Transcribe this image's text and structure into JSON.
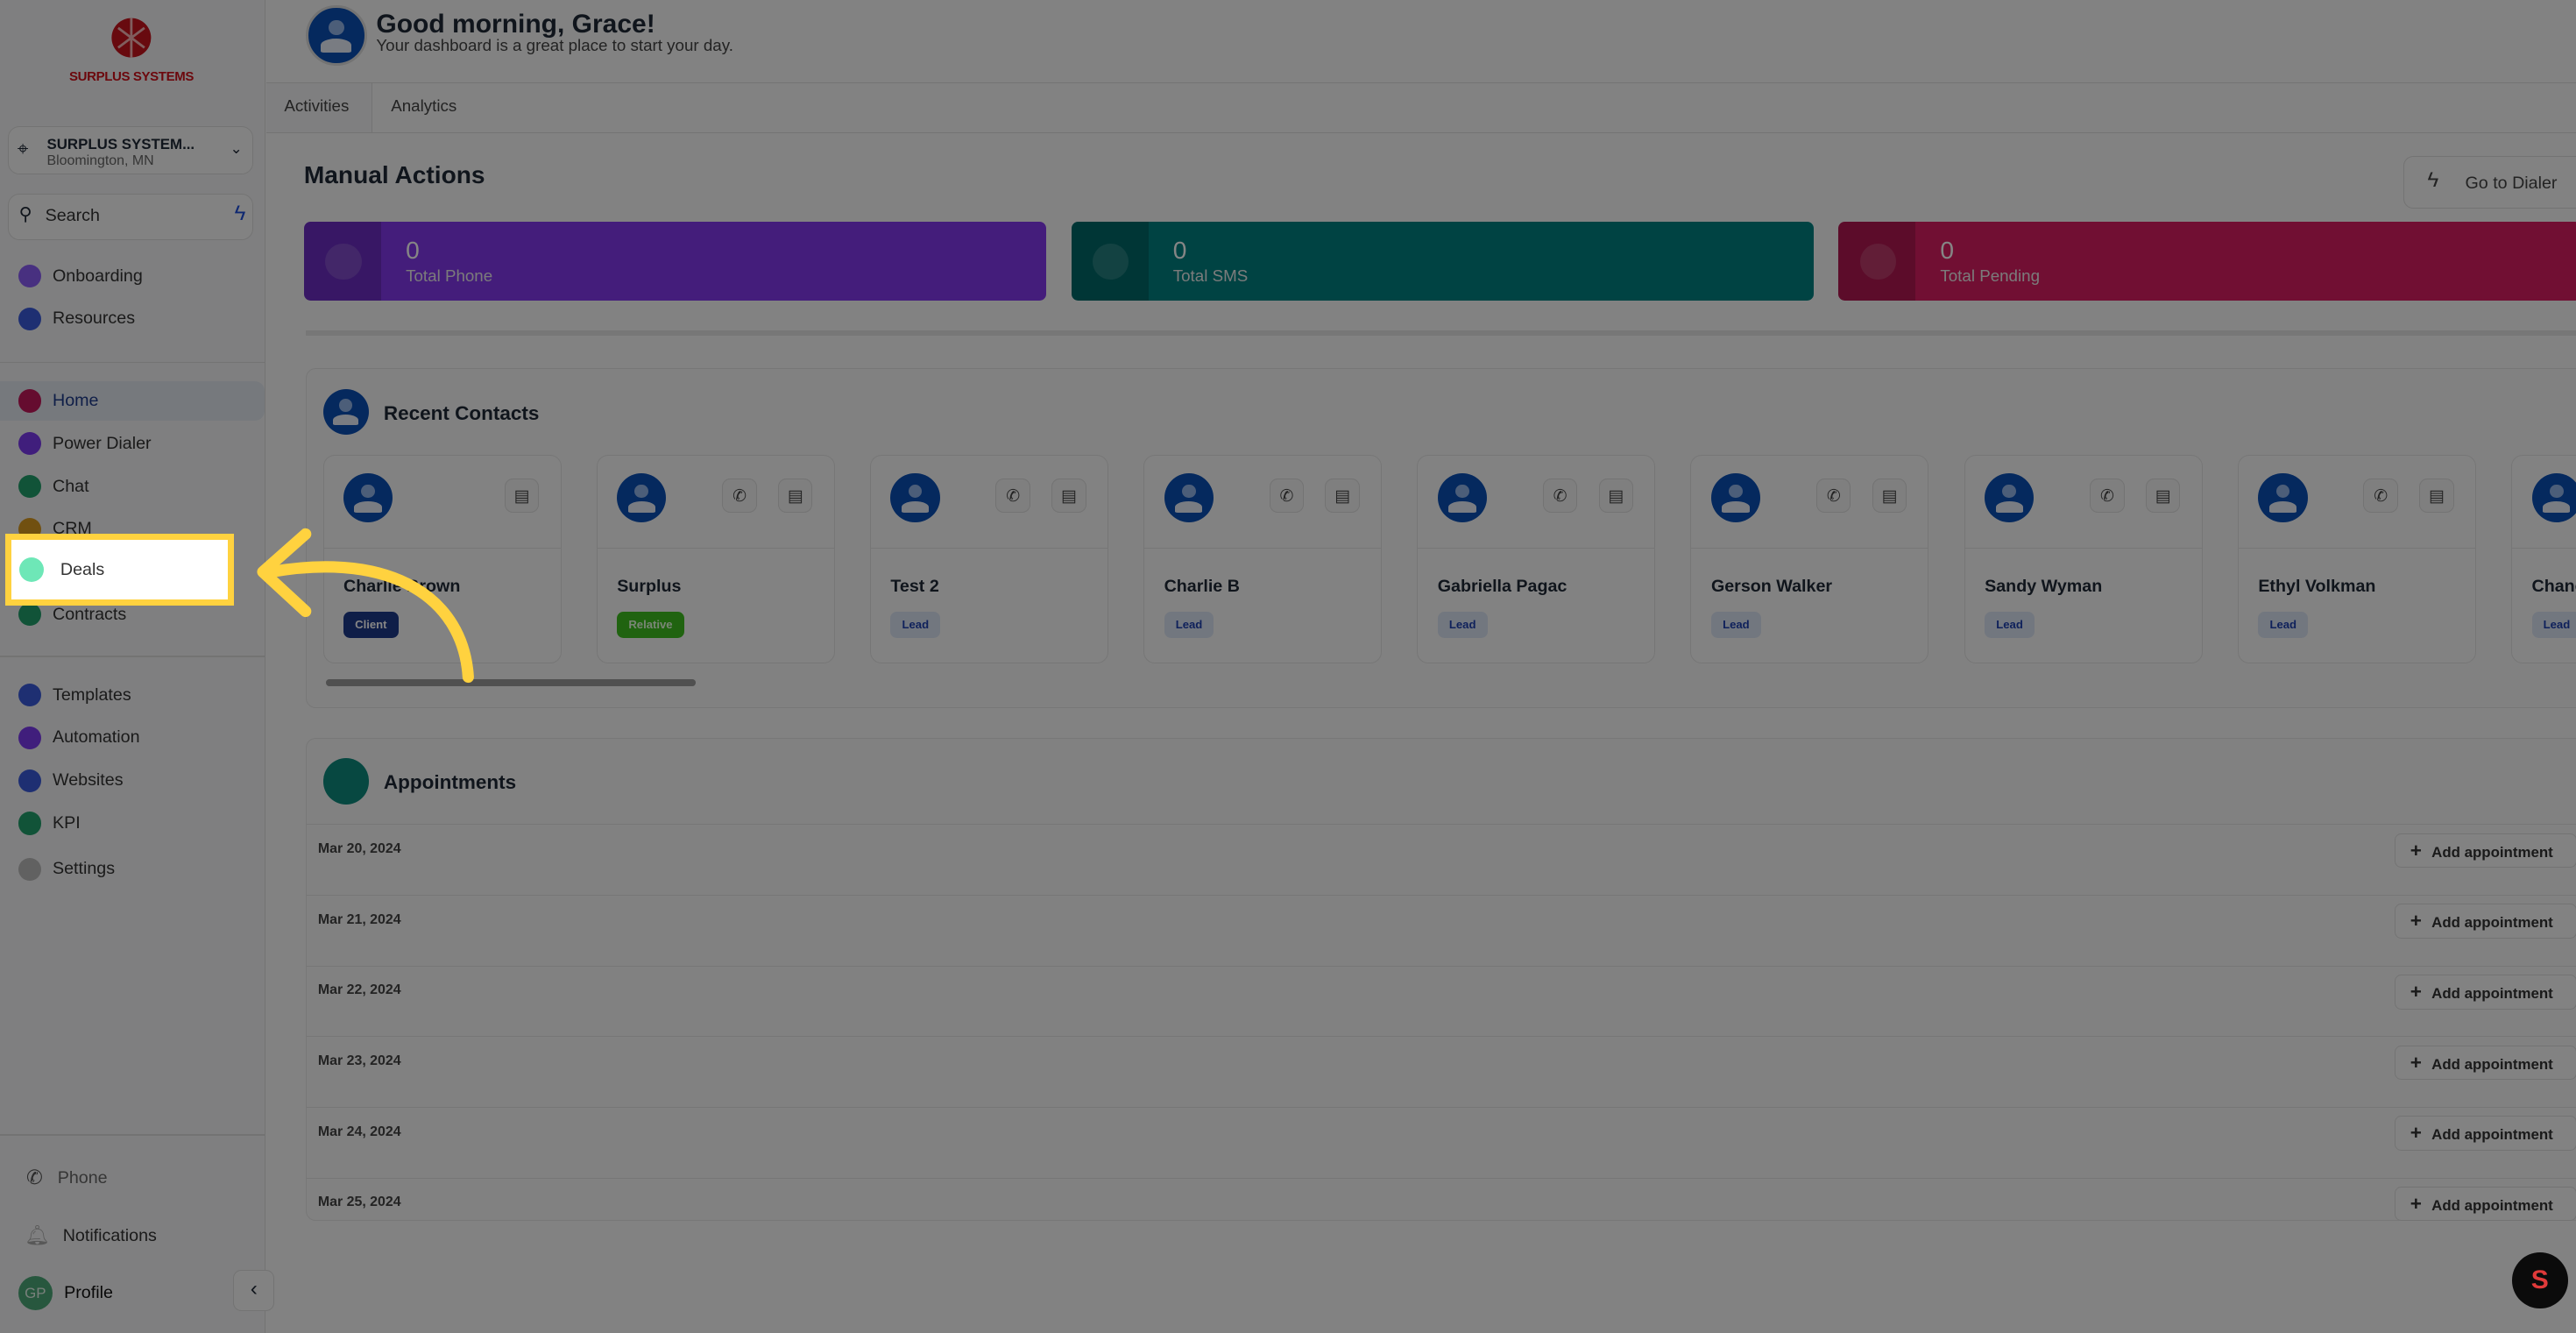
{
  "brand": {
    "logo_text": "SURPLUS SYSTEMS"
  },
  "location": {
    "name": "SURPLUS SYSTEM...",
    "city": "Bloomington, MN"
  },
  "search": {
    "placeholder": "Search"
  },
  "sidebar": {
    "top": [
      {
        "label": "Onboarding",
        "color": "#8b5cf6"
      },
      {
        "label": "Resources",
        "color": "#3b5bdb"
      }
    ],
    "main": [
      {
        "label": "Home",
        "color": "#c2185b",
        "active": true
      },
      {
        "label": "Power Dialer",
        "color": "#7c3aed"
      },
      {
        "label": "Chat",
        "color": "#22a06b"
      },
      {
        "label": "CRM",
        "color": "#d99a1f"
      },
      {
        "label": "Deals",
        "color": "#6ee7b7"
      },
      {
        "label": "Contracts",
        "color": "#22a06b"
      }
    ],
    "tools": [
      {
        "label": "Templates",
        "color": "#3b5bdb"
      },
      {
        "label": "Automation",
        "color": "#7c3aed"
      },
      {
        "label": "Websites",
        "color": "#3b5bdb"
      },
      {
        "label": "KPI",
        "color": "#22a06b"
      },
      {
        "label": "Settings",
        "color": "#bbbbbb"
      }
    ],
    "footer": {
      "phone": "Phone",
      "notifications": "Notifications",
      "profile": "Profile",
      "initials": "GP"
    }
  },
  "header": {
    "greeting": "Good morning, Grace!",
    "subtitle": "Your dashboard is a great place to start your day."
  },
  "tabs": [
    "Activities",
    "Analytics"
  ],
  "manual_actions": {
    "title": "Manual Actions",
    "dialer_button": "Go to Dialer",
    "stats": [
      {
        "value": "0",
        "label": "Total Phone",
        "color": "#8338ec"
      },
      {
        "value": "0",
        "label": "Total SMS",
        "color": "#008080"
      },
      {
        "value": "0",
        "label": "Total Pending",
        "color": "#d81e63"
      }
    ]
  },
  "recent_contacts": {
    "title": "Recent Contacts",
    "contacts": [
      {
        "name": "Charlie Brown",
        "tag": "Client",
        "phone": false
      },
      {
        "name": "Surplus",
        "tag": "Relative",
        "phone": true
      },
      {
        "name": "Test 2",
        "tag": "Lead",
        "phone": true
      },
      {
        "name": "Charlie B",
        "tag": "Lead",
        "phone": true
      },
      {
        "name": "Gabriella Pagac",
        "tag": "Lead",
        "phone": true
      },
      {
        "name": "Gerson Walker",
        "tag": "Lead",
        "phone": true
      },
      {
        "name": "Sandy Wyman",
        "tag": "Lead",
        "phone": true
      },
      {
        "name": "Ethyl Volkman",
        "tag": "Lead",
        "phone": true
      },
      {
        "name": "Chance",
        "tag": "Lead",
        "phone": true
      }
    ],
    "tag_colors": {
      "Client": [
        "#1e3a8a",
        "#ffffff"
      ],
      "Relative": [
        "#3fbf1f",
        "#e8ffe0"
      ],
      "Lead": [
        "#dbe4f3",
        "#1e40af"
      ]
    }
  },
  "appointments": {
    "title": "Appointments",
    "button": "Add appointment",
    "dates": [
      "Mar 20, 2024",
      "Mar 21, 2024",
      "Mar 22, 2024",
      "Mar 23, 2024",
      "Mar 24, 2024",
      "Mar 25, 2024"
    ]
  },
  "highlight": {
    "color": "#ffd23f"
  }
}
